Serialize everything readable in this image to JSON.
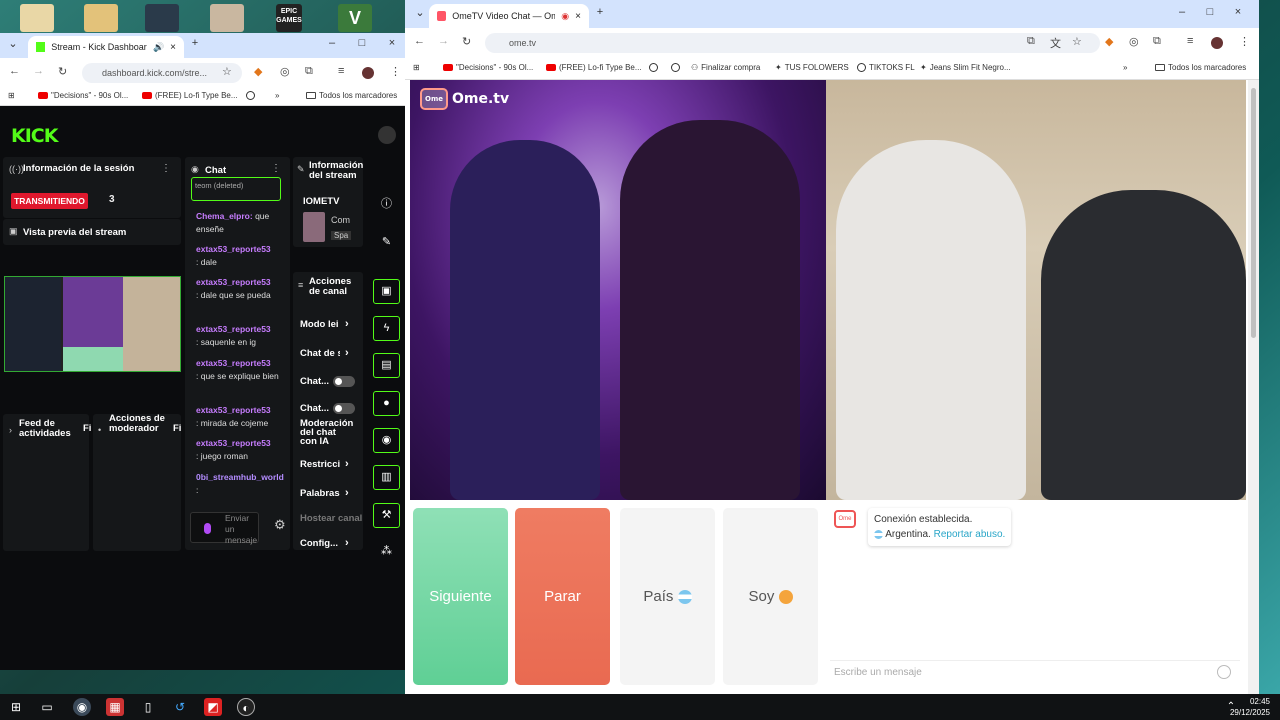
{
  "desktop": {
    "icons": [
      "folder-icon",
      "folder-icon",
      "app-icon",
      "app-icon",
      "epic-games-icon",
      "gta-icon"
    ],
    "epic_label": "EPIC GAMES"
  },
  "left_browser": {
    "tab_title": "Stream - Kick Dashboard",
    "url": "dashboard.kick.com/stre...",
    "bookmarks": [
      "\"Decisions\" - 90s Ol...",
      "(FREE) Lo-fi Type Be...",
      "Todos los marcadores"
    ]
  },
  "kick": {
    "logo": "KICK",
    "session": {
      "title": "Información de la sesión",
      "live_label": "TRANSMITIENDO",
      "viewers": "3",
      "preview_title": "Vista previa del stream"
    },
    "chat": {
      "title": "Chat",
      "messages": [
        {
          "user": "",
          "text": "teom (deleted)"
        },
        {
          "user": "Chema_elpro:",
          "text": "que enseñe"
        },
        {
          "user": "extax53_reporte53",
          "text": ": dale"
        },
        {
          "user": "extax53_reporte53",
          "text": ": dale que se pueda"
        },
        {
          "user": "extax53_reporte53",
          "text": ": saquenle en ig"
        },
        {
          "user": "extax53_reporte53",
          "text": ": que se explique bien"
        },
        {
          "user": "extax53_reporte53",
          "text": ": mirada de cojeme"
        },
        {
          "user": "extax53_reporte53",
          "text": ": juego roman"
        },
        {
          "user": "0bi_streamhub_world",
          "text": ":"
        }
      ],
      "input_placeholder": "Enviar un mensaje"
    },
    "stream_info": {
      "title": "Información del stream",
      "name": "IOMETV",
      "line1": "Com",
      "line2": "Spa"
    },
    "channel_actions": {
      "title": "Acciones de canal",
      "items": [
        "Modo lei",
        "Chat de s",
        "Chat...",
        "Chat...",
        "Moderación del chat con IA",
        "Restricci",
        "Palabras",
        "Hostear canal",
        "Config..."
      ]
    },
    "feed": {
      "title": "Feed de actividades",
      "filter": "Fi"
    },
    "mod_actions": {
      "title": "Acciones de moderador",
      "filter": "Fi"
    }
  },
  "right_browser": {
    "tab_title": "OmeTV Video Chat — Ome",
    "url": "ome.tv",
    "bookmarks": [
      "\"Decisions\" - 90s Ol...",
      "(FREE) Lo-fi Type Be...",
      "Finalizar compra",
      "TUS FOLOWERS",
      "TIKTOKS FL",
      "Jeans Slim Fit Negro...",
      "Todos los marcadores"
    ]
  },
  "ometv": {
    "logo": "Ome.tv",
    "buttons": {
      "next": "Siguiente",
      "stop": "Parar",
      "country": "País",
      "me": "Soy"
    },
    "chat": {
      "status": "Conexión establecida.",
      "country": "Argentina.",
      "report": "Reportar abuso.",
      "placeholder": "Escribe un mensaje"
    },
    "colors": {
      "next": "#6fd6a0",
      "stop": "#ef7a5f",
      "neutral": "#f3f3f3"
    }
  },
  "taskbar": {
    "time": "02:45",
    "date": "29/12/2025"
  }
}
